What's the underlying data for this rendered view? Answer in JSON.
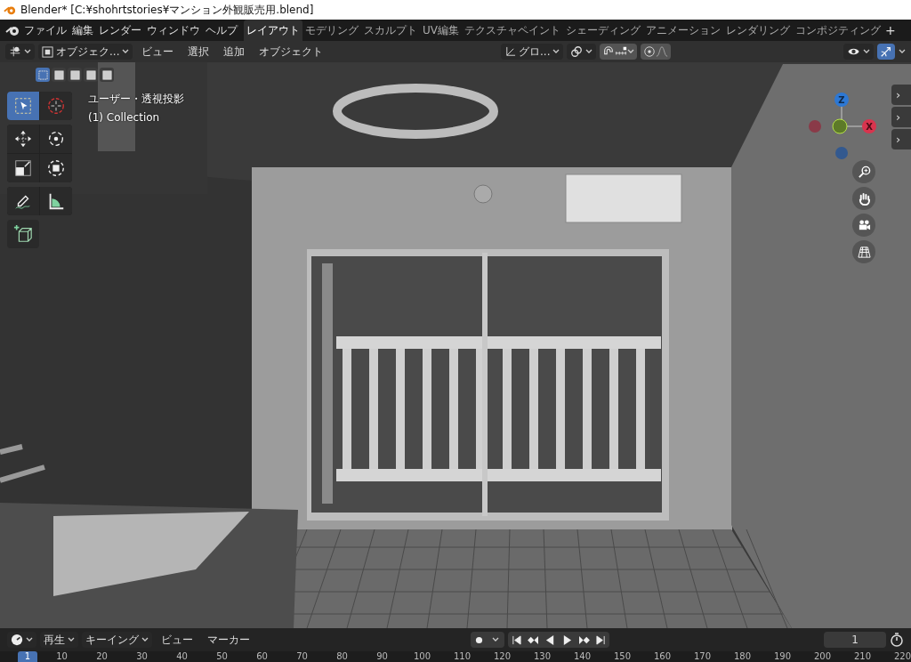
{
  "window": {
    "title": "Blender* [C:¥shohrtstories¥マンション外観販売用.blend]"
  },
  "menu": [
    "ファイル",
    "編集",
    "レンダー",
    "ウィンドウ",
    "ヘルプ"
  ],
  "workspace_tabs": [
    {
      "label": "レイアウト",
      "selected": true
    },
    {
      "label": "モデリング",
      "selected": false
    },
    {
      "label": "スカルプト",
      "selected": false
    },
    {
      "label": "UV編集",
      "selected": false
    },
    {
      "label": "テクスチャペイント",
      "selected": false
    },
    {
      "label": "シェーディング",
      "selected": false
    },
    {
      "label": "アニメーション",
      "selected": false
    },
    {
      "label": "レンダリング",
      "selected": false
    },
    {
      "label": "コンポジティング",
      "selected": false
    }
  ],
  "add_workspace": "+",
  "header": {
    "mode": "オブジェク...",
    "menus": [
      "ビュー",
      "選択",
      "追加",
      "オブジェクト"
    ],
    "orientation": "グロ...",
    "toggles": [
      {
        "kind": "snap",
        "on": true
      },
      {
        "kind": "proportional",
        "on": true
      }
    ],
    "gizmo_toggle_on": true
  },
  "select_modes": [
    {
      "selected": true
    },
    {
      "selected": false
    },
    {
      "selected": false
    },
    {
      "selected": false
    },
    {
      "selected": false
    }
  ],
  "tool_groups": [
    {
      "tools": [
        {
          "kind": "select",
          "selected": true
        },
        {
          "kind": "cursor",
          "selected": false
        }
      ]
    },
    {
      "tools": [
        {
          "kind": "move",
          "selected": false
        },
        {
          "kind": "rotate",
          "selected": false
        },
        {
          "kind": "scale",
          "selected": false
        },
        {
          "kind": "transform",
          "selected": false
        }
      ]
    },
    {
      "tools": [
        {
          "kind": "annotate",
          "selected": false
        },
        {
          "kind": "measure",
          "selected": false
        }
      ]
    },
    {
      "tools": [
        {
          "kind": "add_cube",
          "selected": false
        }
      ]
    }
  ],
  "viewport": {
    "view_name": "ユーザー・透視投影",
    "collection": "(1) Collection",
    "axis_z": "Z",
    "axis_x": "X",
    "side_tabs": [
      "›",
      "›",
      "›"
    ]
  },
  "timeline": {
    "menus": [
      {
        "label": "再生",
        "dropdown": true
      },
      {
        "label": "キーイング",
        "dropdown": true
      },
      {
        "label": "ビュー",
        "dropdown": false
      },
      {
        "label": "マーカー",
        "dropdown": false
      }
    ],
    "current_frame": "1",
    "current_marker": "1",
    "ticks": [
      "10",
      "20",
      "30",
      "40",
      "50",
      "60",
      "70",
      "80",
      "90",
      "100",
      "110",
      "120",
      "130",
      "140",
      "150",
      "160",
      "170",
      "180",
      "190",
      "200",
      "210",
      "220"
    ]
  }
}
